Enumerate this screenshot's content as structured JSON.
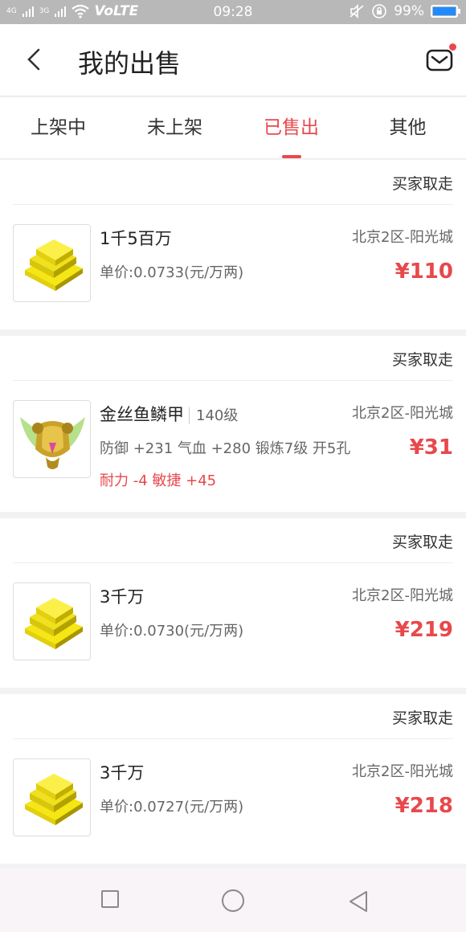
{
  "statusbar": {
    "net1": "4G",
    "net2": "3G",
    "volte": "VoLTE",
    "time": "09:28",
    "battery_text": "99%",
    "battery_level": 0.99
  },
  "header": {
    "title": "我的出售"
  },
  "tabs": [
    {
      "label": "上架中",
      "active": false
    },
    {
      "label": "未上架",
      "active": false
    },
    {
      "label": "已售出",
      "active": true
    },
    {
      "label": "其他",
      "active": false
    }
  ],
  "orders": [
    {
      "status": "买家取走",
      "name": "1千5百万",
      "level": "",
      "line2": "单价:0.0733(元/万两)",
      "line3": "",
      "server": "北京2区-阳光城",
      "price": "¥110",
      "icon": "gold-bars-icon"
    },
    {
      "status": "买家取走",
      "name": "金丝鱼鳞甲",
      "level": "140级",
      "line2": "防御 +231 气血 +280 锻炼7级 开5孔",
      "line3": "耐力 -4 敏捷 +45",
      "server": "北京2区-阳光城",
      "price": "¥31",
      "icon": "armor-icon"
    },
    {
      "status": "买家取走",
      "name": "3千万",
      "level": "",
      "line2": "单价:0.0730(元/万两)",
      "line3": "",
      "server": "北京2区-阳光城",
      "price": "¥219",
      "icon": "gold-bars-icon"
    },
    {
      "status": "买家取走",
      "name": "3千万",
      "level": "",
      "line2": "单价:0.0727(元/万两)",
      "line3": "",
      "server": "北京2区-阳光城",
      "price": "¥218",
      "icon": "gold-bars-icon"
    }
  ],
  "colors": {
    "accent": "#e8484c",
    "statusbar": "#b8b8b8",
    "battery": "#1e8bff"
  }
}
